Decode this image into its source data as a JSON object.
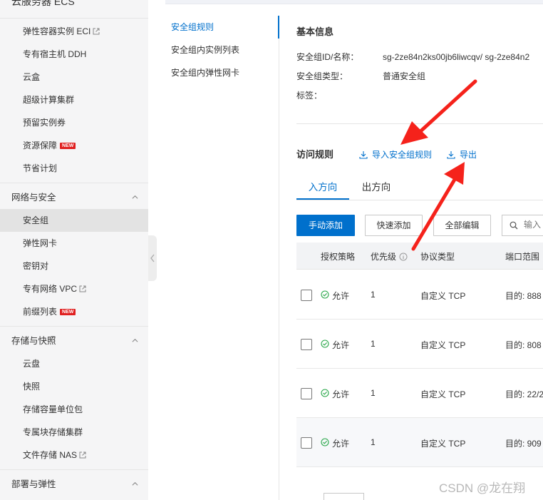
{
  "sidebar": {
    "top_label": "云服务器 ECS",
    "items_top": [
      {
        "label": "弹性容器实例 ECI",
        "external": true
      },
      {
        "label": "专有宿主机 DDH"
      },
      {
        "label": "云盒"
      },
      {
        "label": "超级计算集群"
      },
      {
        "label": "预留实例券"
      },
      {
        "label": "资源保障",
        "badge": "NEW"
      },
      {
        "label": "节省计划"
      }
    ],
    "groups": [
      {
        "title": "网络与安全",
        "items": [
          {
            "label": "安全组",
            "active": true
          },
          {
            "label": "弹性网卡"
          },
          {
            "label": "密钥对"
          },
          {
            "label": "专有网络 VPC",
            "external": true
          },
          {
            "label": "前缀列表",
            "badge": "NEW"
          }
        ]
      },
      {
        "title": "存储与快照",
        "items": [
          {
            "label": "云盘"
          },
          {
            "label": "快照"
          },
          {
            "label": "存储容量单位包"
          },
          {
            "label": "专属块存储集群"
          },
          {
            "label": "文件存储 NAS",
            "external": true
          }
        ]
      },
      {
        "title": "部署与弹性",
        "items": []
      }
    ]
  },
  "subnav": {
    "items": [
      {
        "label": "安全组规则",
        "active": true
      },
      {
        "label": "安全组内实例列表"
      },
      {
        "label": "安全组内弹性网卡"
      }
    ]
  },
  "basic_info": {
    "title": "基本信息",
    "rows": [
      {
        "label": "安全组ID/名称：",
        "value": "sg-2ze84n2ks00jb6liwcqv/ sg-2ze84n2"
      },
      {
        "label": "安全组类型：",
        "value": "普通安全组"
      },
      {
        "label": "标签：",
        "value": ""
      }
    ]
  },
  "access_rules": {
    "title": "访问规则",
    "import_label": "导入安全组规则",
    "export_label": "导出",
    "tabs": [
      {
        "label": "入方向",
        "active": true
      },
      {
        "label": "出方向"
      }
    ],
    "buttons": {
      "manual_add": "手动添加",
      "quick_add": "快速添加",
      "edit_all": "全部编辑"
    },
    "search_placeholder": "输入",
    "columns": [
      "授权策略",
      "优先级",
      "协议类型",
      "端口范围"
    ],
    "rows": [
      {
        "policy": "允许",
        "priority": "1",
        "protocol": "自定义 TCP",
        "port": "目的: 888"
      },
      {
        "policy": "允许",
        "priority": "1",
        "protocol": "自定义 TCP",
        "port": "目的: 808"
      },
      {
        "policy": "允许",
        "priority": "1",
        "protocol": "自定义 TCP",
        "port": "目的: 22/2"
      },
      {
        "policy": "允许",
        "priority": "1",
        "protocol": "自定义 TCP",
        "port": "目的: 909"
      }
    ]
  },
  "watermark": "CSDN @龙在翔",
  "colors": {
    "accent": "#0070cc",
    "allow": "#2aa84a",
    "arrow": "#f5221b",
    "new_badge": "#e02020"
  }
}
